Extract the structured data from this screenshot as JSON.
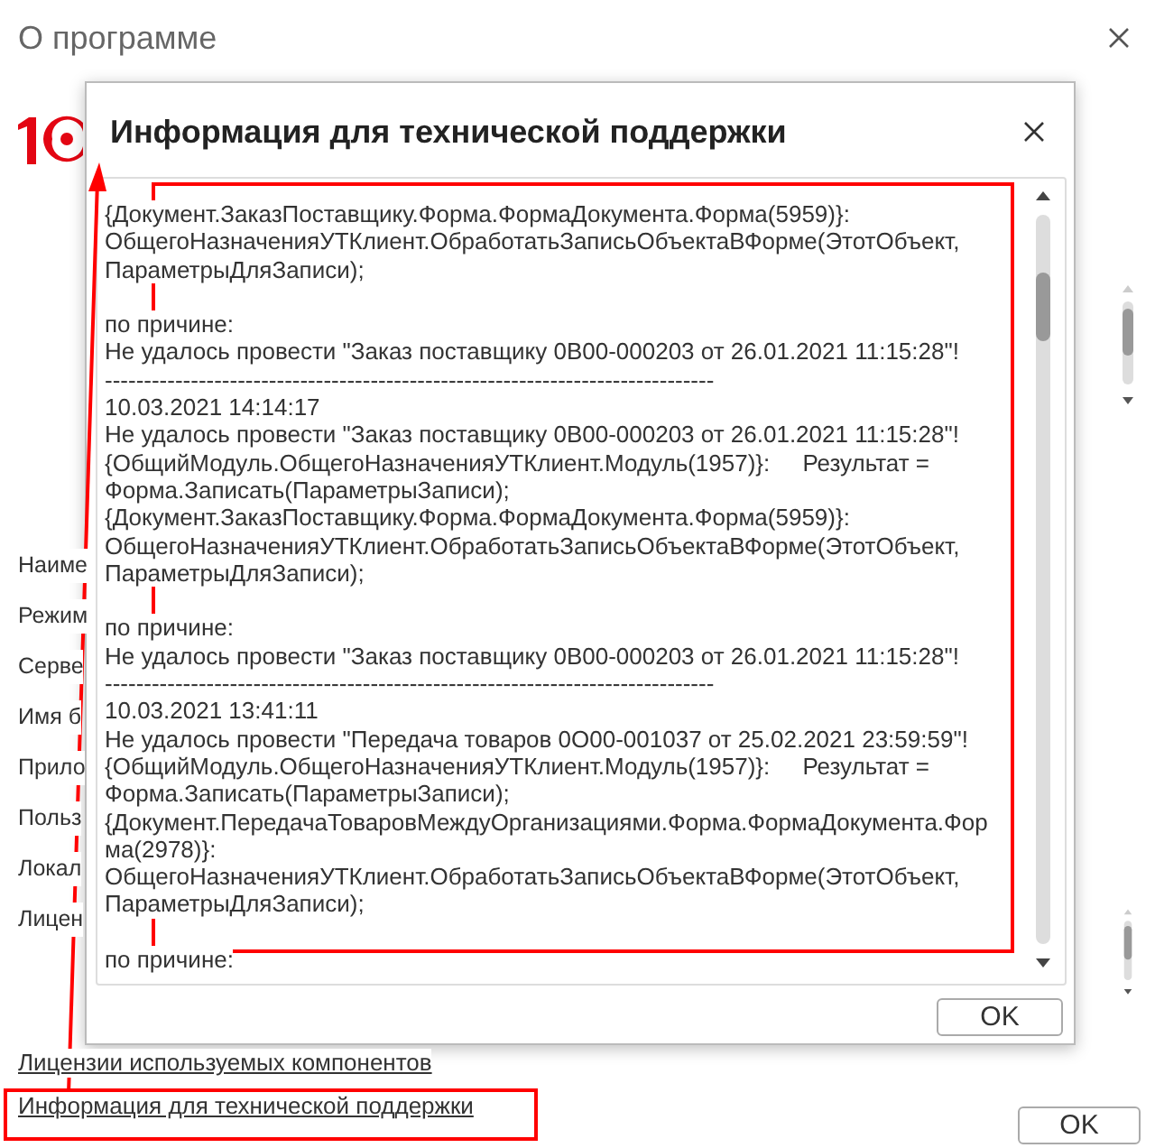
{
  "window": {
    "title": "О программе"
  },
  "fields": [
    "Наиме",
    "Режим",
    "Серве",
    "Имя б",
    "Прило",
    "Польз",
    "Локал",
    "Лицен"
  ],
  "links": [
    "Лицензии используемых компонентов",
    "Информация для технической поддержки"
  ],
  "ok_button": "OK",
  "dialog": {
    "title": "Информация для технической поддержки",
    "blocks": [
      {
        "lines": [
          "{Документ.ЗаказПоставщику.Форма.ФормаДокумента.Форма(5959)}:",
          "ОбщегоНазначенияУТКлиент.ОбработатьЗаписьОбъектаВФорме(ЭтотОбъект,",
          "ПараметрыДляЗаписи);"
        ]
      },
      {
        "lines": [
          "по причине:",
          "Не удалось провести \"Заказ поставщику 0В00-000203 от 26.01.2021 11:15:28\"!",
          "------------------------------------------------------------------------------",
          "10.03.2021 14:14:17",
          "Не удалось провести \"Заказ поставщику 0В00-000203 от 26.01.2021 11:15:28\"!",
          "{ОбщийМодуль.ОбщегоНазначенияУТКлиент.Модуль(1957)}:     Результат =",
          "Форма.Записать(ПараметрыЗаписи);",
          "{Документ.ЗаказПоставщику.Форма.ФормаДокумента.Форма(5959)}:",
          "ОбщегоНазначенияУТКлиент.ОбработатьЗаписьОбъектаВФорме(ЭтотОбъект,",
          "ПараметрыДляЗаписи);"
        ]
      },
      {
        "lines": [
          "по причине:",
          "Не удалось провести \"Заказ поставщику 0В00-000203 от 26.01.2021 11:15:28\"!",
          "------------------------------------------------------------------------------",
          "10.03.2021 13:41:11",
          "Не удалось провести \"Передача товаров 0О00-001037 от 25.02.2021 23:59:59\"!",
          "{ОбщийМодуль.ОбщегоНазначенияУТКлиент.Модуль(1957)}:     Результат =",
          "Форма.Записать(ПараметрыЗаписи);",
          "{Документ.ПередачаТоваровМеждуОрганизациями.Форма.ФормаДокумента.Фор",
          "ма(2978)}:",
          "ОбщегоНазначенияУТКлиент.ОбработатьЗаписьОбъектаВФорме(ЭтотОбъект,",
          "ПараметрыДляЗаписи);"
        ]
      },
      {
        "lines": [
          "по причине:"
        ]
      }
    ],
    "ok_button": "OK"
  }
}
